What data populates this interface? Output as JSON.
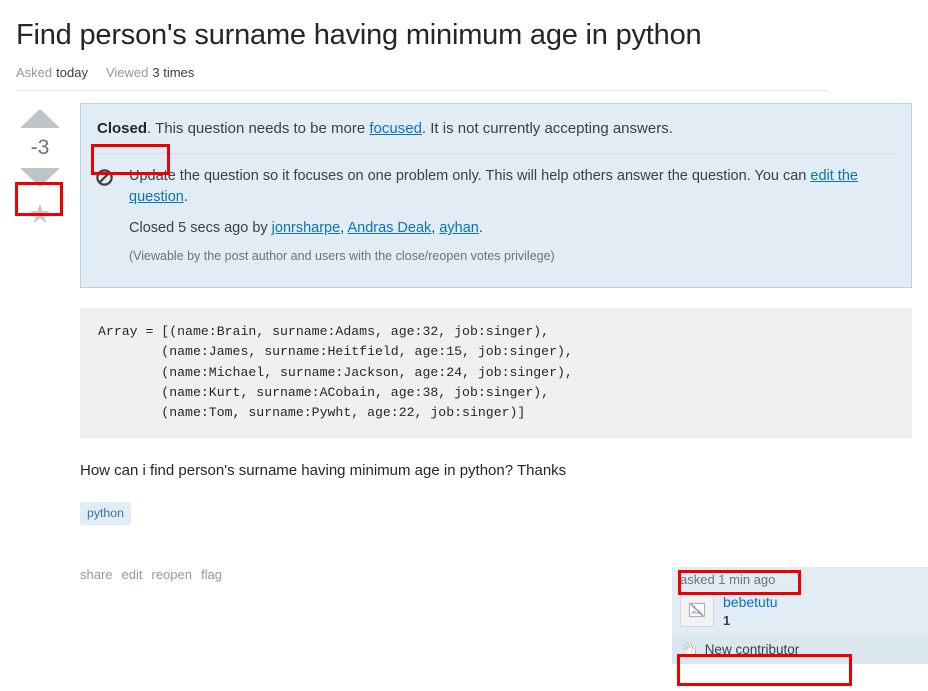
{
  "header": {
    "title": "Find person's surname having minimum age in python",
    "stats": [
      {
        "label": "Asked",
        "value": "today"
      },
      {
        "label": "Viewed",
        "value": "3 times"
      }
    ]
  },
  "vote": {
    "up_icon": "arrow-up-icon",
    "down_icon": "arrow-down-icon",
    "score": "-3",
    "favorite_icon": "star-icon"
  },
  "closed_notice": {
    "icon": "no-entry-icon",
    "head_bold": "Closed",
    "head_before_link": ". This question needs to be more ",
    "head_link": "focused",
    "head_after_link": ". It is not currently accepting answers.",
    "body_text": "Update the question so it focuses on one problem only. This will help others answer the question. You can ",
    "body_link": "edit the question",
    "body_text_end": ".",
    "closed_by_prefix": "Closed 5 secs ago by ",
    "closed_by_users": [
      "jonrsharpe",
      "Andras Deak",
      "ayhan"
    ],
    "closed_by_suffix": ".",
    "privilege_note": "(Viewable by the post author and users with the close/reopen votes privilege)"
  },
  "post": {
    "code": "Array = [(name:Brain, surname:Adams, age:32, job:singer),\n        (name:James, surname:Heitfield, age:15, job:singer),\n        (name:Michael, surname:Jackson, age:24, job:singer),\n        (name:Kurt, surname:ACobain, age:38, job:singer),\n        (name:Tom, surname:Pywht, age:22, job:singer)]",
    "text": "How can i find person's surname having minimum age in python? Thanks",
    "tags": [
      "python"
    ],
    "actions": [
      "share",
      "edit",
      "reopen",
      "flag"
    ]
  },
  "user_card": {
    "action_time": "asked 1 min ago",
    "avatar_icon": "broken-image-icon",
    "user_name": "bebetutu",
    "reputation": "1",
    "badge_icon": "waving-hand-icon",
    "badge_label": "New contributor"
  },
  "colors": {
    "notice_bg": "#e1ecf4",
    "notice_border": "#b3d3ea",
    "link": "#0c73b8",
    "tag_text": "#39739d",
    "code_bg": "#eff0f1",
    "annotation": "#ee0000",
    "vote_arrow": "#bdc3c7"
  }
}
